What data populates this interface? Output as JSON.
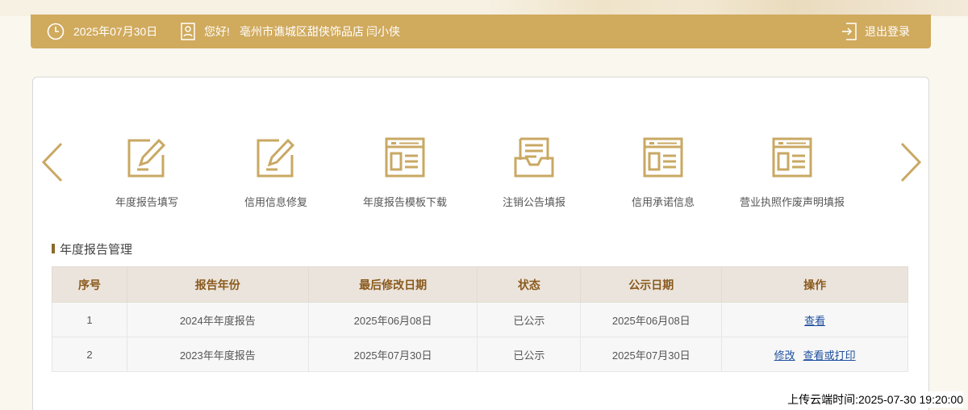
{
  "header": {
    "date": "2025年07月30日",
    "greeting": "您好!",
    "shop_name": "亳州市谯城区甜侠饰品店",
    "user_name": "闫小侠",
    "logout_label": "退出登录"
  },
  "functions": [
    {
      "label": "年度报告填写",
      "icon": "edit-form-icon"
    },
    {
      "label": "信用信息修复",
      "icon": "edit-form-icon"
    },
    {
      "label": "年度报告模板下载",
      "icon": "document-template-icon"
    },
    {
      "label": "注销公告填报",
      "icon": "inbox-tray-icon"
    },
    {
      "label": "信用承诺信息",
      "icon": "document-template-icon"
    },
    {
      "label": "营业执照作废声明填报",
      "icon": "document-template-icon"
    }
  ],
  "section": {
    "title": "年度报告管理"
  },
  "table": {
    "columns": [
      "序号",
      "报告年份",
      "最后修改日期",
      "状态",
      "公示日期",
      "操作"
    ],
    "rows": [
      {
        "no": "1",
        "year": "2024年年度报告",
        "modified": "2025年06月08日",
        "status": "已公示",
        "published": "2025年06月08日",
        "actions": [
          "查看"
        ]
      },
      {
        "no": "2",
        "year": "2023年年度报告",
        "modified": "2025年07月30日",
        "status": "已公示",
        "published": "2025年07月30日",
        "actions": [
          "修改",
          "查看或打印"
        ]
      }
    ]
  },
  "footer": {
    "upload_time": "上传云端时间:2025-07-30 19:20:00"
  },
  "colors": {
    "gold": "#d0aa5d",
    "header_text": "#8a5a1d",
    "link": "#1f4fa0"
  }
}
